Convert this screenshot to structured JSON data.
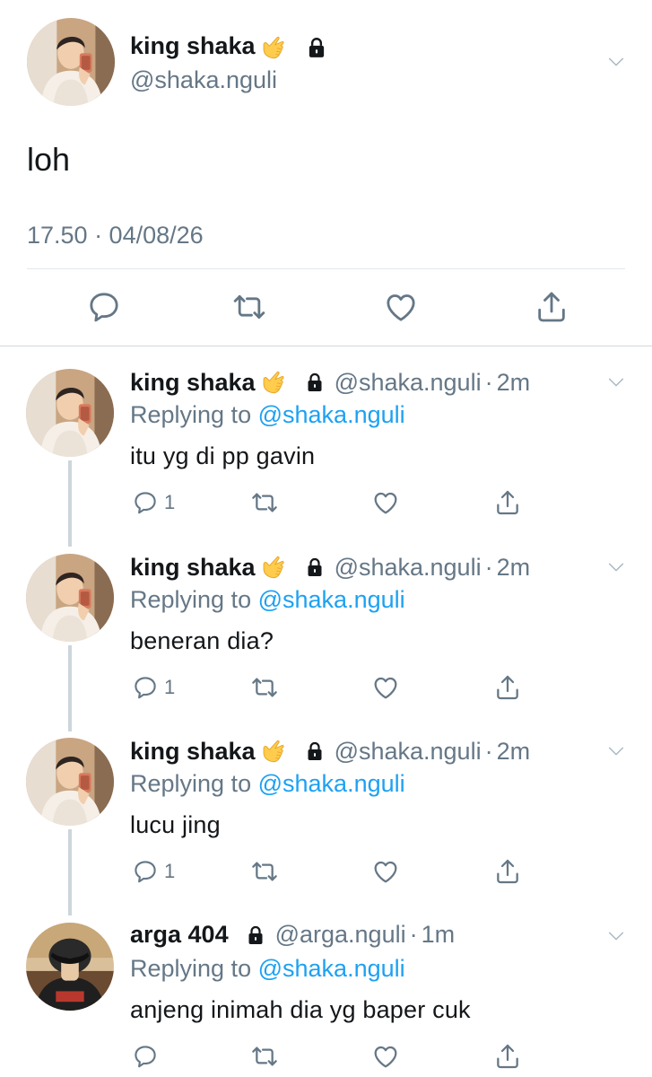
{
  "main_tweet": {
    "author_name": "king shaka",
    "author_handle": "@shaka.nguli",
    "text": "loh",
    "timestamp": "17.50 · 04/08/26",
    "icons": [
      "hand-emoji-icon",
      "lock-icon",
      "chevron-down-icon",
      "reply-icon",
      "retweet-icon",
      "like-icon",
      "share-icon"
    ]
  },
  "replies": [
    {
      "author_name": "king shaka",
      "author_handle": "@shaka.nguli",
      "separator": "·",
      "time": "2m",
      "replying_prefix": "Replying to",
      "replying_mention": "@shaka.nguli",
      "text": "itu yg di pp gavin",
      "reply_count": "1"
    },
    {
      "author_name": "king shaka",
      "author_handle": "@shaka.nguli",
      "separator": "·",
      "time": "2m",
      "replying_prefix": "Replying to",
      "replying_mention": "@shaka.nguli",
      "text": "beneran dia?",
      "reply_count": "1"
    },
    {
      "author_name": "king shaka",
      "author_handle": "@shaka.nguli",
      "separator": "·",
      "time": "2m",
      "replying_prefix": "Replying to",
      "replying_mention": "@shaka.nguli",
      "text": "lucu jing",
      "reply_count": "1"
    },
    {
      "author_name": "arga 404",
      "author_handle": "@arga.nguli",
      "separator": "·",
      "time": "1m",
      "replying_prefix": "Replying to",
      "replying_mention": "@shaka.nguli",
      "text": "anjeng inimah dia yg baper cuk",
      "reply_count": ""
    }
  ],
  "colors": {
    "text": "#14171a",
    "muted": "#657786",
    "link": "#1da1f2",
    "divider": "#e1e8ed",
    "thread_line": "#ccd6dd"
  }
}
